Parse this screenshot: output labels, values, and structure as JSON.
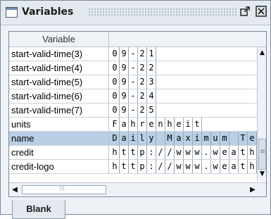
{
  "window": {
    "title": "Variables",
    "icons": {
      "window": "window-icon",
      "maximize": "maximize-icon",
      "close": "close-icon"
    }
  },
  "table": {
    "column_header": "Variable",
    "rows": [
      {
        "label": "start-valid-time(3)",
        "chars": [
          "0",
          "9",
          "-",
          "2",
          "1"
        ]
      },
      {
        "label": "start-valid-time(4)",
        "chars": [
          "0",
          "9",
          "-",
          "2",
          "2"
        ]
      },
      {
        "label": "start-valid-time(5)",
        "chars": [
          "0",
          "9",
          "-",
          "2",
          "3"
        ]
      },
      {
        "label": "start-valid-time(6)",
        "chars": [
          "0",
          "9",
          "-",
          "2",
          "4"
        ]
      },
      {
        "label": "start-valid-time(7)",
        "chars": [
          "0",
          "9",
          "-",
          "2",
          "5"
        ]
      },
      {
        "label": "units",
        "chars": [
          "F",
          "a",
          "h",
          "r",
          "e",
          "n",
          "h",
          "e",
          "i",
          "t"
        ]
      },
      {
        "label": "name",
        "chars": [
          "D",
          "a",
          "i",
          "l",
          "y",
          " ",
          "M",
          "a",
          "x",
          "i",
          "m",
          "u",
          "m",
          " ",
          "T",
          "e"
        ],
        "selected": true
      },
      {
        "label": "credit",
        "chars": [
          "h",
          "t",
          "t",
          "p",
          ":",
          "/",
          "/",
          "w",
          "w",
          "w",
          ".",
          "w",
          "e",
          "a",
          "t",
          "h"
        ]
      },
      {
        "label": "credit-logo",
        "chars": [
          "h",
          "t",
          "t",
          "p",
          ":",
          "/",
          "/",
          "w",
          "w",
          "w",
          ".",
          "w",
          "e",
          "a",
          "t",
          "h"
        ]
      }
    ]
  },
  "scrollbars": {
    "up": "▲",
    "down": "▼",
    "left": "◀",
    "right": "▶"
  },
  "tabs": {
    "active": "Blank"
  }
}
